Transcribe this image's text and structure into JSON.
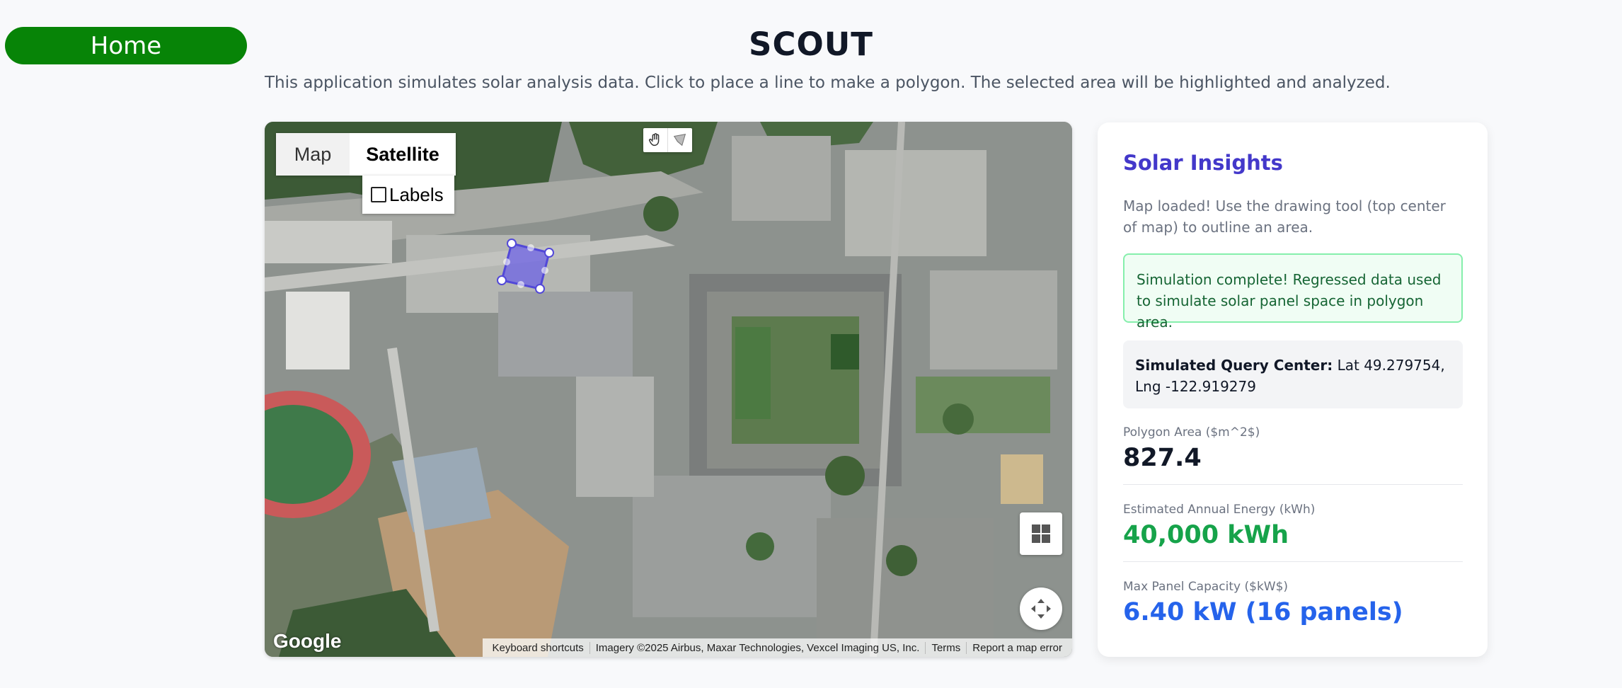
{
  "nav": {
    "home_label": "Home"
  },
  "header": {
    "title": "SCOUT",
    "subtitle": "This application simulates solar analysis data. Click to place a line to make a polygon. The selected area will be highlighted and analyzed."
  },
  "map": {
    "type_controls": {
      "map_label": "Map",
      "satellite_label": "Satellite",
      "selected": "Satellite"
    },
    "labels_label": "Labels",
    "labels_checked": false,
    "drawing_tools": [
      "hand-icon",
      "polygon-draw-icon"
    ],
    "logo": "Google",
    "attribution": {
      "shortcuts": "Keyboard shortcuts",
      "imagery": "Imagery ©2025 Airbus, Maxar Technologies, Vexcel Imaging US, Inc.",
      "terms": "Terms",
      "report": "Report a map error"
    },
    "polygon_color": "#6e63e6"
  },
  "panel": {
    "title": "Solar Insights",
    "message": "Map loaded! Use the drawing tool (top center of map) to outline an area.",
    "success": "Simulation complete! Regressed data used to simulate solar panel space in polygon area.",
    "query_center_label": "Simulated Query Center:",
    "query_center_value": "Lat 49.279754, Lng -122.919279",
    "metrics": [
      {
        "label": "Polygon Area ($m^2$)",
        "value": "827.4",
        "color": "#111827"
      },
      {
        "label": "Estimated Annual Energy (kWh)",
        "value": "40,000 kWh",
        "color": "#16a34a"
      },
      {
        "label": "Max Panel Capacity ($kW$)",
        "value": "6.40 kW (16 panels)",
        "color": "#2563eb"
      }
    ]
  },
  "colors": {
    "home_button": "#078407",
    "panel_title": "#4338ca",
    "success_bg": "#f0fdf4",
    "success_border": "#86efac"
  }
}
